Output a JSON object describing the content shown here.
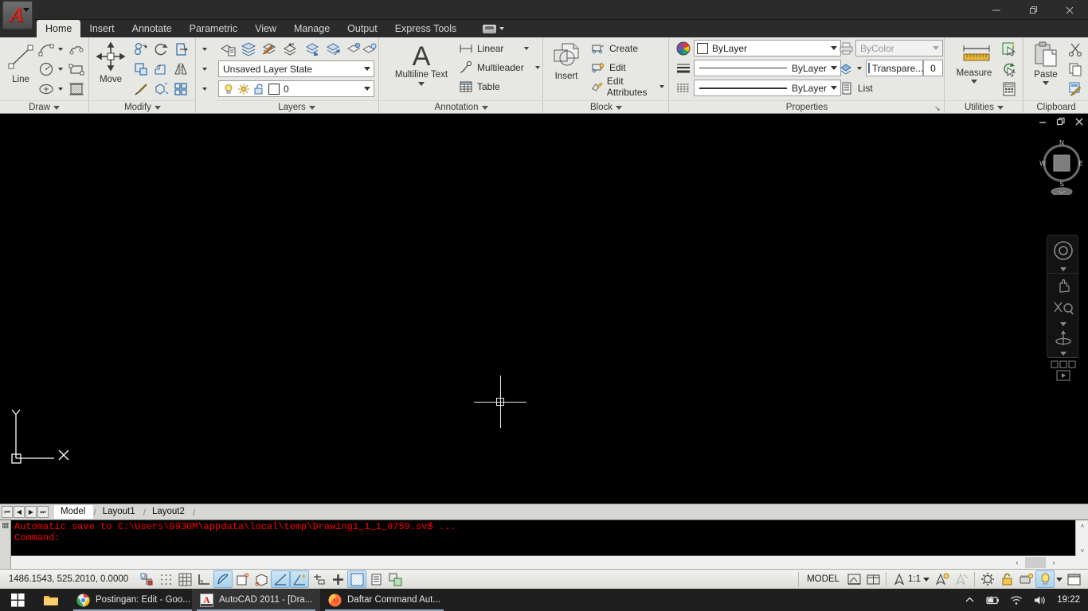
{
  "window": {
    "minimize": "–",
    "restore": "❐",
    "close": "✕"
  },
  "ribbon_tabs": [
    {
      "label": "Home",
      "active": true
    },
    {
      "label": "Insert",
      "active": false
    },
    {
      "label": "Annotate",
      "active": false
    },
    {
      "label": "Parametric",
      "active": false
    },
    {
      "label": "View",
      "active": false
    },
    {
      "label": "Manage",
      "active": false
    },
    {
      "label": "Output",
      "active": false
    },
    {
      "label": "Express Tools",
      "active": false
    }
  ],
  "workspace_switch": {
    "icon": "workspace-icon"
  },
  "panels": {
    "draw": {
      "title": "Draw",
      "big_button": {
        "label": "Line",
        "icon": "line-icon"
      },
      "tools": [
        "arc-icon",
        "revcloud-icon",
        "circle-icon",
        "rectangle-icon",
        "ellipse-icon",
        "hatch-icon"
      ]
    },
    "modify": {
      "title": "Modify",
      "big_button": {
        "label": "Move",
        "icon": "move-icon"
      },
      "tools": [
        "copy-icon",
        "rotate-icon",
        "trim-icon",
        "stretch-icon",
        "scale-icon",
        "mirror-icon",
        "fillet-icon",
        "array-icon",
        "explode-icon"
      ]
    },
    "layers": {
      "title": "Layers",
      "layer_state": {
        "value": "Unsaved Layer State"
      },
      "layer_current": {
        "value": "0",
        "color": "#ffffff"
      },
      "tools": [
        "layer-properties-icon",
        "layer-isolate-icon",
        "layer-match-icon",
        "layer-previous-icon",
        "layer-make-current-icon",
        "layer-off-icon",
        "layer-freeze-icon",
        "layer-on-icon"
      ]
    },
    "annotation": {
      "title": "Annotation",
      "big_button": {
        "label": "Multiline Text",
        "icon": "text-A-icon"
      },
      "rows": [
        {
          "label": "Linear",
          "icon": "linear-dim-icon",
          "has_arrow": true
        },
        {
          "label": "Multileader",
          "icon": "multileader-icon",
          "has_arrow": true
        },
        {
          "label": "Table",
          "icon": "table-icon",
          "has_arrow": false
        }
      ]
    },
    "block": {
      "title": "Block",
      "big_button": {
        "label": "Insert",
        "icon": "insert-block-icon"
      },
      "rows": [
        {
          "label": "Create",
          "icon": "create-block-icon",
          "has_arrow": false
        },
        {
          "label": "Edit",
          "icon": "edit-block-icon",
          "has_arrow": false
        },
        {
          "label": "Edit Attributes",
          "icon": "edit-attributes-icon",
          "has_arrow": true
        }
      ]
    },
    "properties": {
      "title": "Properties",
      "color": {
        "value": "ByLayer",
        "swatch": "#ffffff"
      },
      "linetype": {
        "value": "ByLayer"
      },
      "lineweight": {
        "value": "ByLayer"
      },
      "plotstyle": {
        "value": "ByColor",
        "disabled": true
      },
      "transparency": {
        "label": "Transpare...",
        "value": "0"
      },
      "list": {
        "label": "List",
        "icon": "list-icon"
      },
      "expand": "↘"
    },
    "utilities": {
      "title": "Utilities",
      "big_button": {
        "label": "Measure",
        "icon": "measure-icon"
      },
      "tools": [
        "quick-select-icon",
        "quick-calc-update-icon",
        "calculator-icon"
      ]
    },
    "clipboard": {
      "title": "Clipboard",
      "big_button": {
        "label": "Paste",
        "icon": "paste-icon"
      },
      "tools": [
        "cut-icon",
        "copy-icon",
        "match-properties-icon"
      ]
    }
  },
  "drawing_window": {
    "minimize": "–",
    "restore": "❐",
    "close": "✕",
    "viewcube": {
      "north": "N",
      "south": "S",
      "east": "E",
      "west": "W"
    },
    "navbar_items": [
      "steering-wheel-icon",
      "pan-icon",
      "zoom-extents-icon",
      "orbit-icon",
      "showmotion-icon"
    ],
    "ucs": {
      "x_label": "X",
      "y_label": "Y"
    }
  },
  "layout_tabs": {
    "nav": [
      "first-tab-icon",
      "prev-tab-icon",
      "next-tab-icon",
      "last-tab-icon"
    ],
    "tabs": [
      {
        "label": "Model",
        "active": true
      },
      {
        "label": "Layout1",
        "active": false
      },
      {
        "label": "Layout2",
        "active": false
      }
    ]
  },
  "command_window": {
    "history": [
      "Automatic save to C:\\Users\\G930M\\appdata\\local\\temp\\Drawing1_1_1_0759.sv$ ...",
      "Command:"
    ],
    "prompt": "Command:",
    "text_color": "#ff0000"
  },
  "status_bar": {
    "coordinates": "1486.1543, 525.2010, 0.0000",
    "toggles": [
      {
        "name": "infer-constraints",
        "on": false
      },
      {
        "name": "snap-mode",
        "on": false
      },
      {
        "name": "grid-display",
        "on": false
      },
      {
        "name": "ortho-mode",
        "on": false
      },
      {
        "name": "polar-tracking",
        "on": true
      },
      {
        "name": "object-snap",
        "on": false
      },
      {
        "name": "3d-object-snap",
        "on": false
      },
      {
        "name": "object-snap-tracking",
        "on": true
      },
      {
        "name": "dynamic-ucs",
        "on": true
      },
      {
        "name": "dynamic-input",
        "on": false
      },
      {
        "name": "lineweight",
        "on": false
      },
      {
        "name": "transparency",
        "on": true
      },
      {
        "name": "quick-properties",
        "on": false
      },
      {
        "name": "selection-cycling",
        "on": false
      }
    ],
    "model_label": "MODEL",
    "space_buttons": [
      "quick-view-layouts-icon",
      "quick-view-drawings-icon"
    ],
    "annotation_scale": "1:1",
    "annotation_visibility": "annotation-visibility-icon",
    "auto_scale": "auto-scale-icon",
    "workspace_gear": "workspace-gear-icon",
    "lock_toolbars": "lock-icon",
    "hardware_accel": "hardware-accel-icon",
    "clean_screen": "clean-screen-icon",
    "tray_light": "status-tray-icon"
  },
  "taskbar": {
    "start": "windows-logo-icon",
    "items": [
      {
        "label": "",
        "icon": "file-explorer-icon",
        "active": false,
        "pinned": true
      },
      {
        "label": "Postingan: Edit - Goo...",
        "icon": "chrome-icon",
        "active": false
      },
      {
        "label": "AutoCAD 2011 - [Dra...",
        "icon": "autocad-icon",
        "active": true
      },
      {
        "label": "Daftar Command Aut...",
        "icon": "firefox-icon",
        "active": false
      }
    ],
    "tray": [
      "show-hidden-icons",
      "battery-icon",
      "wifi-icon",
      "volume-icon"
    ],
    "clock": "19:22"
  }
}
